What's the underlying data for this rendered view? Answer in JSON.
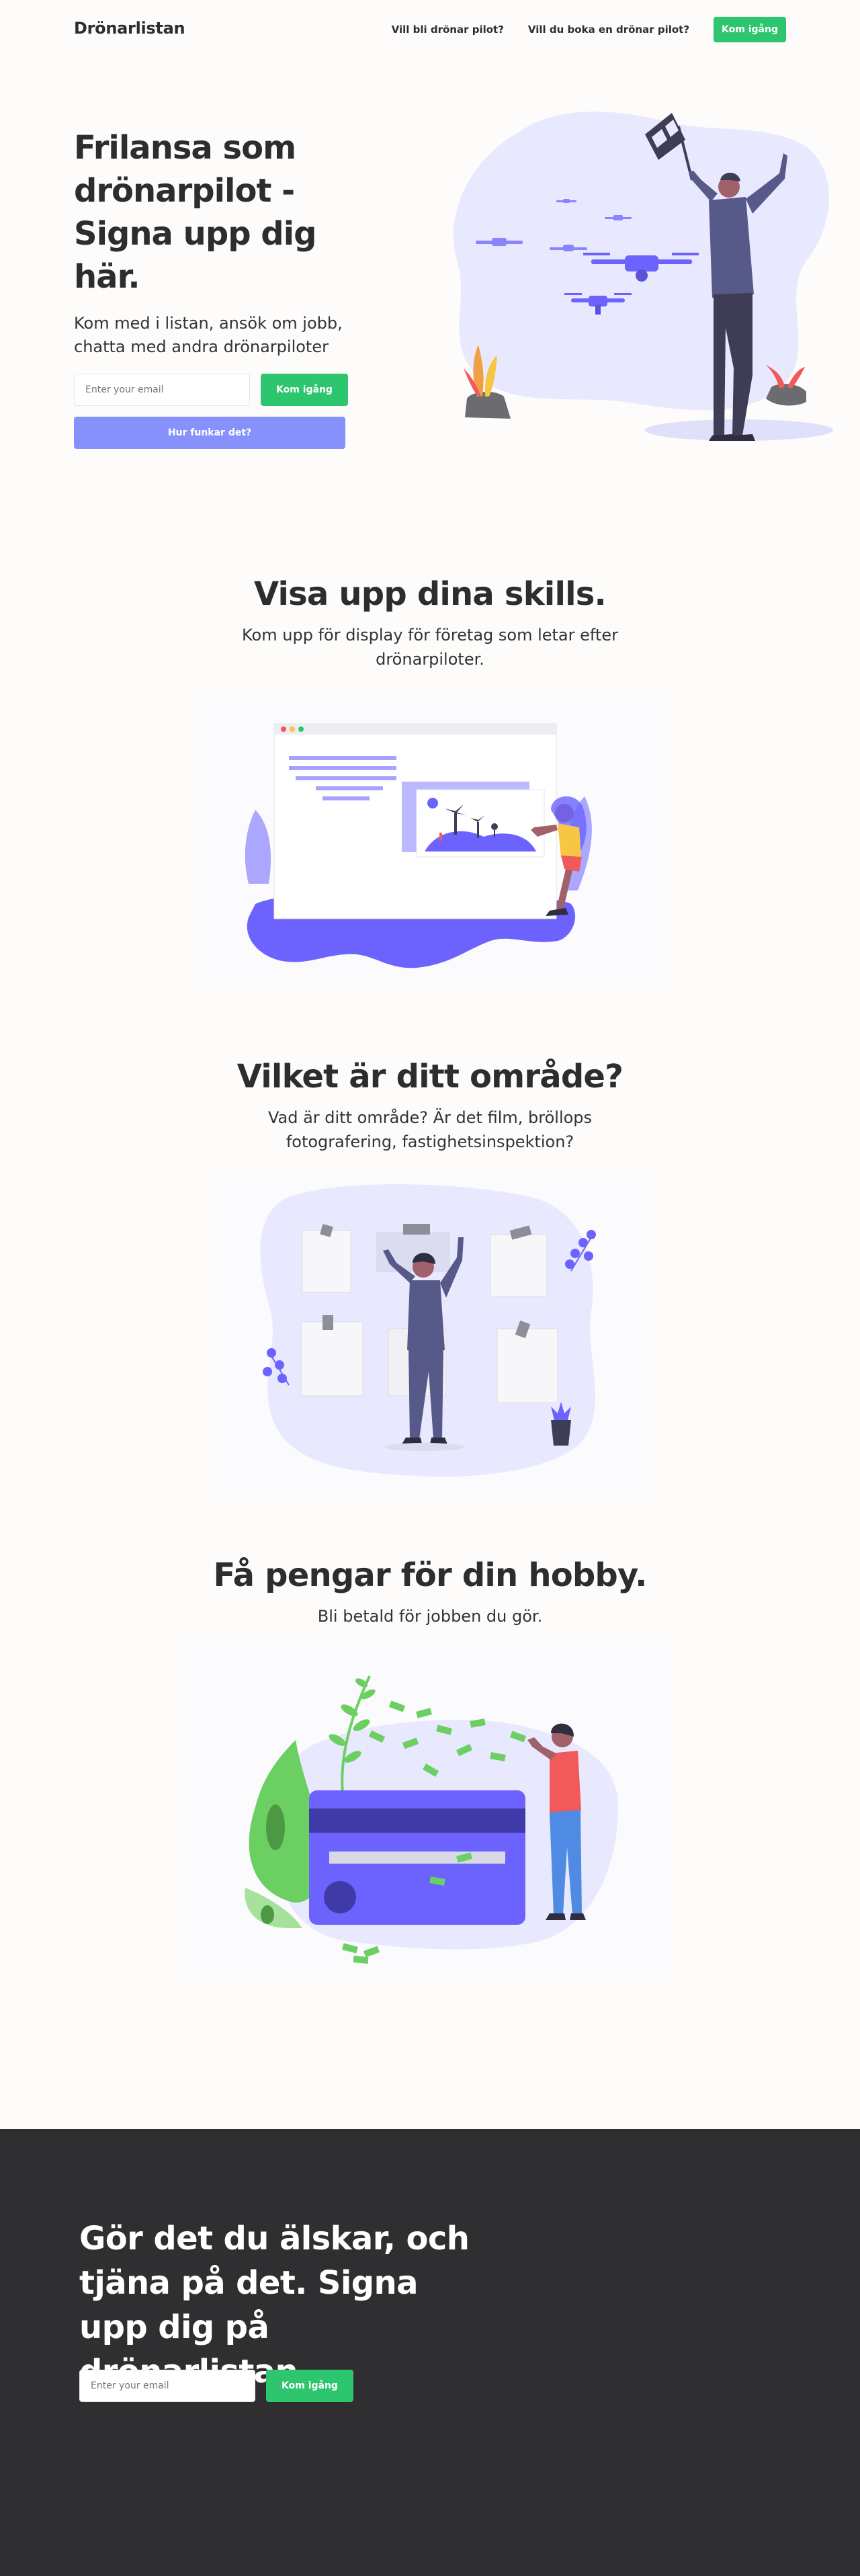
{
  "nav": {
    "brand": "Drönarlistan",
    "links": [
      "Vill bli drönar pilot?",
      "Vill du boka en drönar pilot?"
    ],
    "cta": "Kom igång"
  },
  "hero": {
    "title": "Frilansa som drönarpilot - Signa upp dig här.",
    "subtitle": "Kom med i listan, ansök om jobb, chatta med andra drönarpiloter",
    "email_placeholder": "Enter your email",
    "cta": "Kom igång",
    "howto": "Hur funkar det?"
  },
  "sections": [
    {
      "title": "Visa upp dina skills.",
      "subtitle": "Kom upp för display för företag som letar efter drönarpiloter."
    },
    {
      "title": "Vilket är ditt område?",
      "subtitle": "Vad är ditt område? Är det film, bröllops fotografering, fastighetsinspektion?"
    },
    {
      "title": "Få pengar för din hobby.",
      "subtitle": "Bli betald för jobben du gör."
    }
  ],
  "cta_section": {
    "title": "Gör det du älskar, och tjäna på det. Signa upp dig på drönarlistan.",
    "email_placeholder": "Enter your email",
    "cta": "Kom igång"
  },
  "colors": {
    "accent_green": "#2ec56f",
    "accent_purple": "#8691fb",
    "illustration_purple": "#6c63ff",
    "cta_background": "#2f2f31"
  }
}
